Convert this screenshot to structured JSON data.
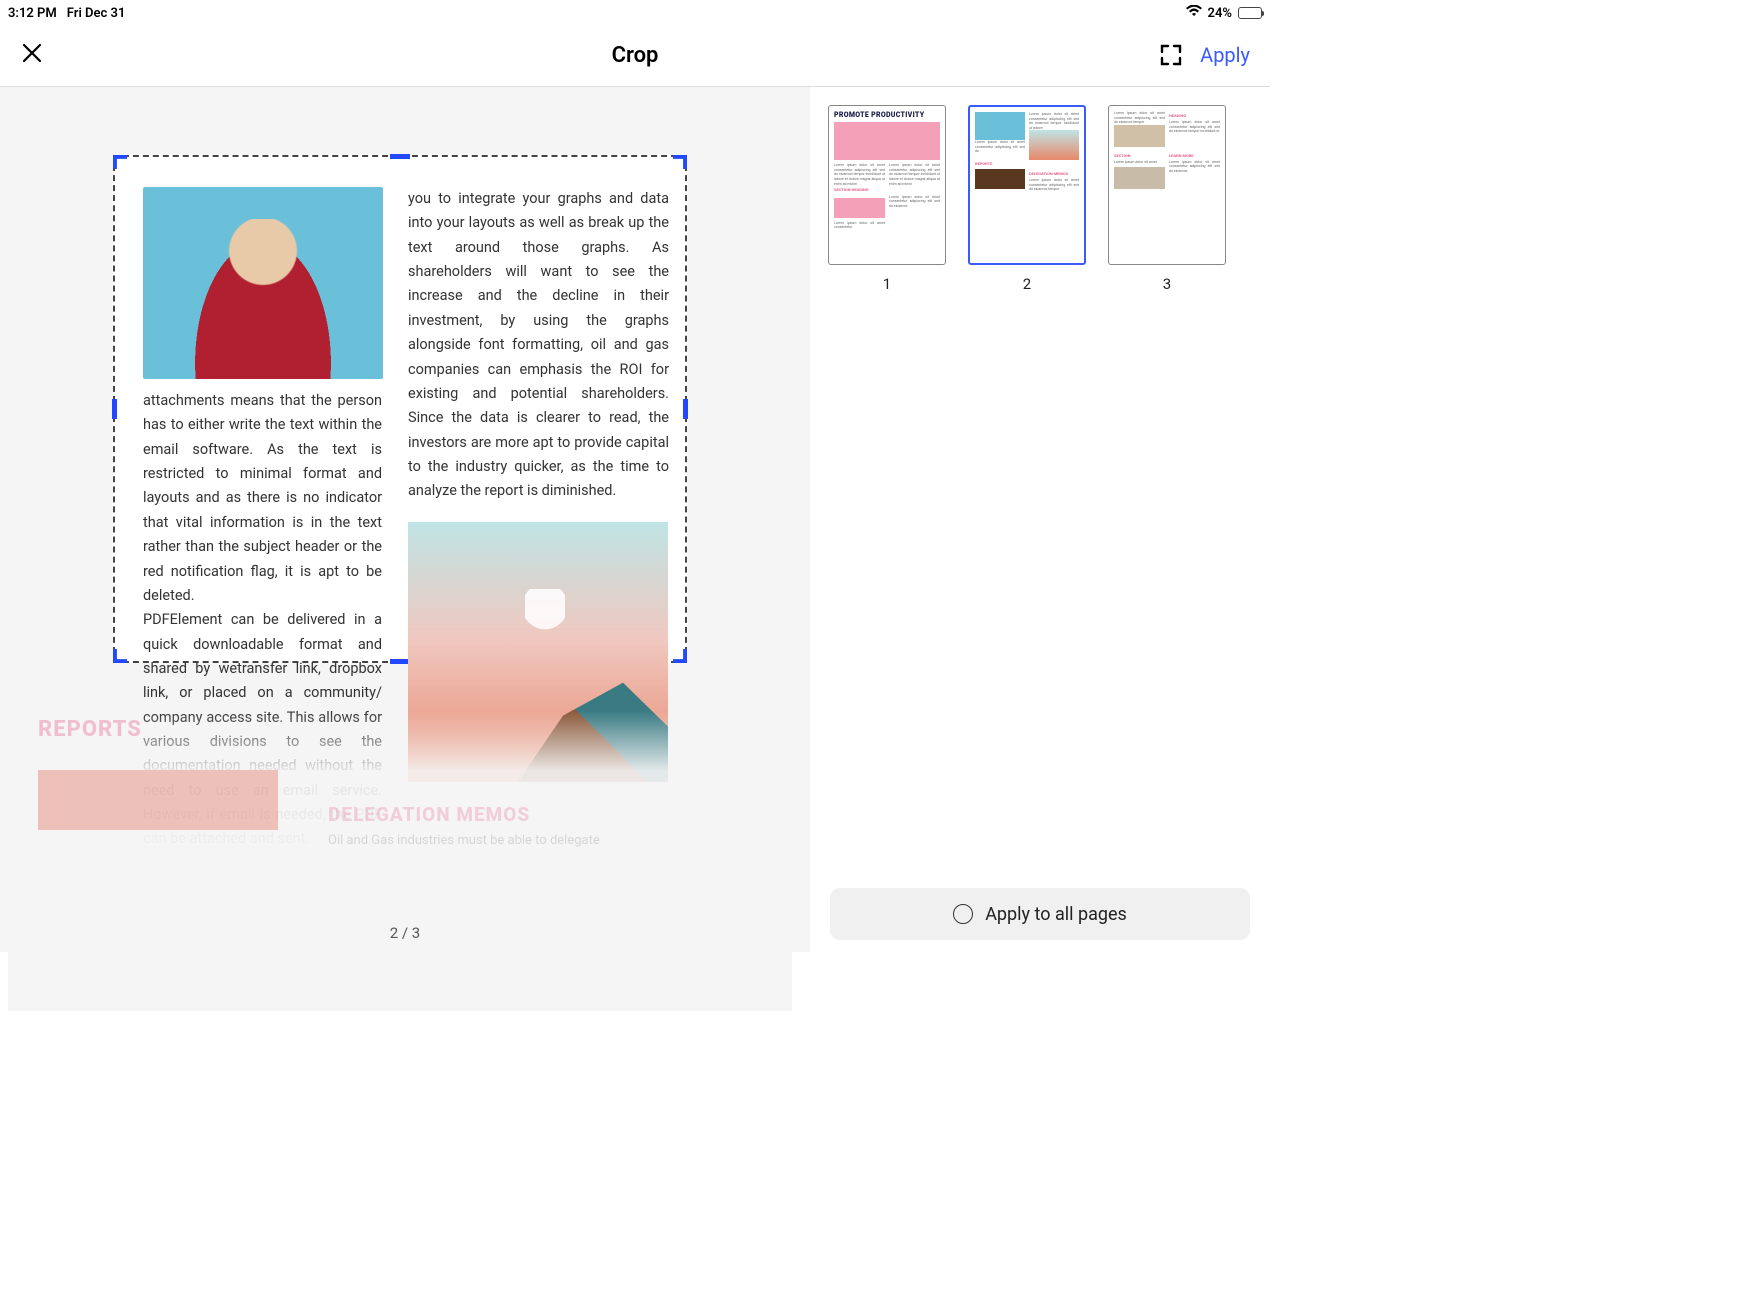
{
  "status": {
    "time": "3:12 PM",
    "date": "Fri Dec 31",
    "battery_pct": "24%"
  },
  "nav": {
    "title": "Crop",
    "apply": "Apply"
  },
  "doc": {
    "left_p1": "attachments means that the person has to either write the text within the email software. As the text is restricted to minimal format and layouts and as there is no indicator that vital information is in the text rather than the subject header or the red notification flag, it is apt to be deleted.",
    "left_p2": "PDFElement can be delivered in a quick downloadable format and shared by wetransfer link, dropbox link, or placed on a community/ company access site. This allows for various divisions to see the documentation needed without the need to use an email service. However, if email is needed, the PDF can be attached and sent.",
    "right_p1": "you to integrate your graphs and data into your layouts as well as break up the text around those graphs. As shareholders will want to see the increase and the decline in their investment, by using the graphs alongside font formatting, oil and gas companies can emphasis the ROI for existing and potential shareholders. Since the data is clearer to read, the investors are more apt to provide capital to the industry quicker, as the time to analyze the report is diminished.",
    "reports_heading": "REPORTS",
    "delegation_heading": "DELEGATION MEMOS",
    "ghost_line": "Oil and Gas industries must be able to delegate"
  },
  "pager": {
    "indicator": "2 / 3"
  },
  "thumbs": {
    "items": [
      {
        "num": "1",
        "title": "PROMOTE PRODUCTIVITY"
      },
      {
        "num": "2",
        "title": ""
      },
      {
        "num": "3",
        "title": ""
      }
    ],
    "selected_index": 1
  },
  "footer": {
    "apply_all": "Apply to all pages"
  }
}
